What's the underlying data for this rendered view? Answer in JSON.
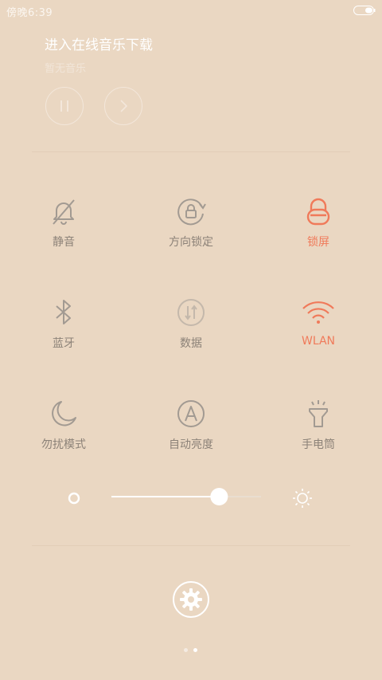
{
  "status": {
    "time": "傍晚6:39"
  },
  "music": {
    "title": "进入在线音乐下载",
    "subtitle": "暂无音乐"
  },
  "toggles": [
    {
      "label": "静音",
      "icon": "silent-bell-icon",
      "active": false
    },
    {
      "label": "方向锁定",
      "icon": "rotation-lock-icon",
      "active": false
    },
    {
      "label": "锁屏",
      "icon": "lock-icon",
      "active": true
    },
    {
      "label": "蓝牙",
      "icon": "bluetooth-icon",
      "active": false
    },
    {
      "label": "数据",
      "icon": "mobile-data-icon",
      "active": false
    },
    {
      "label": "WLAN",
      "icon": "wifi-icon",
      "active": true
    },
    {
      "label": "勿扰模式",
      "icon": "moon-icon",
      "active": false
    },
    {
      "label": "自动亮度",
      "icon": "auto-brightness-icon",
      "active": false
    },
    {
      "label": "手电筒",
      "icon": "flashlight-icon",
      "active": false
    }
  ],
  "brightness": {
    "level": 0.72
  },
  "pager": {
    "pages": 2,
    "current": 2
  },
  "colors": {
    "background": "#ead7c2",
    "active": "#f07a5a",
    "inactive": "#8c8278",
    "icon": "#a29a92"
  }
}
